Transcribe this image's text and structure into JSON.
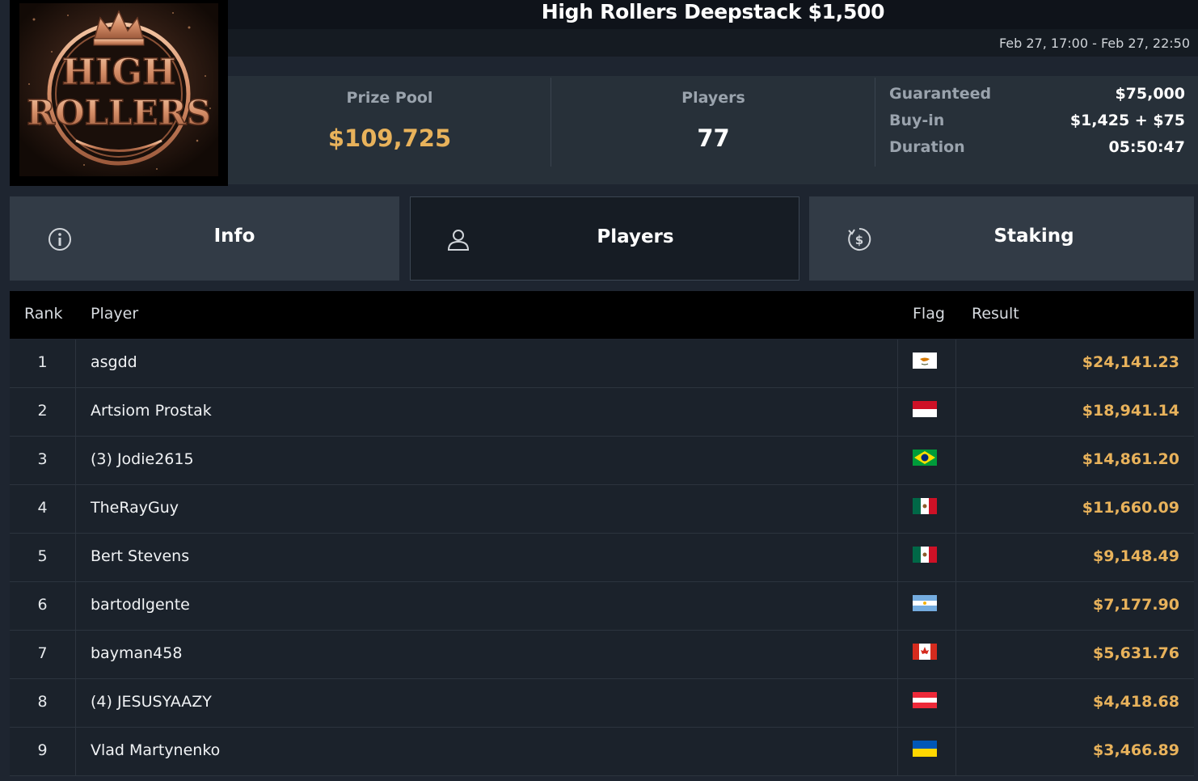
{
  "tournament": {
    "title": "High Rollers Deepstack $1,500",
    "dates": "Feb 27, 17:00 - Feb 27, 22:50",
    "logo": {
      "line1": "HIGH",
      "line2": "ROLLERS"
    }
  },
  "stats": {
    "prize_pool_label": "Prize Pool",
    "prize_pool_value": "$109,725",
    "players_label": "Players",
    "players_value": "77",
    "guaranteed_label": "Guaranteed",
    "guaranteed_value": "$75,000",
    "buyin_label": "Buy-in",
    "buyin_value": "$1,425 + $75",
    "duration_label": "Duration",
    "duration_value": "05:50:47"
  },
  "colors": {
    "accent_gold": "#e8b25b"
  },
  "tabs": [
    {
      "label": "Info",
      "icon": "info-icon"
    },
    {
      "label": "Players",
      "icon": "user-icon"
    },
    {
      "label": "Staking",
      "icon": "dollar-cycle-icon"
    }
  ],
  "table": {
    "headers": {
      "rank": "Rank",
      "player": "Player",
      "flag": "Flag",
      "result": "Result"
    },
    "rows": [
      {
        "rank": "1",
        "player": "asgdd",
        "flag": "cy",
        "result": "$24,141.23"
      },
      {
        "rank": "2",
        "player": "Artsiom Prostak",
        "flag": "id",
        "result": "$18,941.14"
      },
      {
        "rank": "3",
        "player": "(3) Jodie2615",
        "flag": "br",
        "result": "$14,861.20"
      },
      {
        "rank": "4",
        "player": "TheRayGuy",
        "flag": "mx",
        "result": "$11,660.09"
      },
      {
        "rank": "5",
        "player": "Bert Stevens",
        "flag": "mx",
        "result": "$9,148.49"
      },
      {
        "rank": "6",
        "player": "bartodlgente",
        "flag": "ar",
        "result": "$7,177.90"
      },
      {
        "rank": "7",
        "player": "bayman458",
        "flag": "ca",
        "result": "$5,631.76"
      },
      {
        "rank": "8",
        "player": "(4) JESUSYAAZY",
        "flag": "at",
        "result": "$4,418.68"
      },
      {
        "rank": "9",
        "player": "Vlad Martynenko",
        "flag": "ua",
        "result": "$3,466.89"
      }
    ]
  }
}
